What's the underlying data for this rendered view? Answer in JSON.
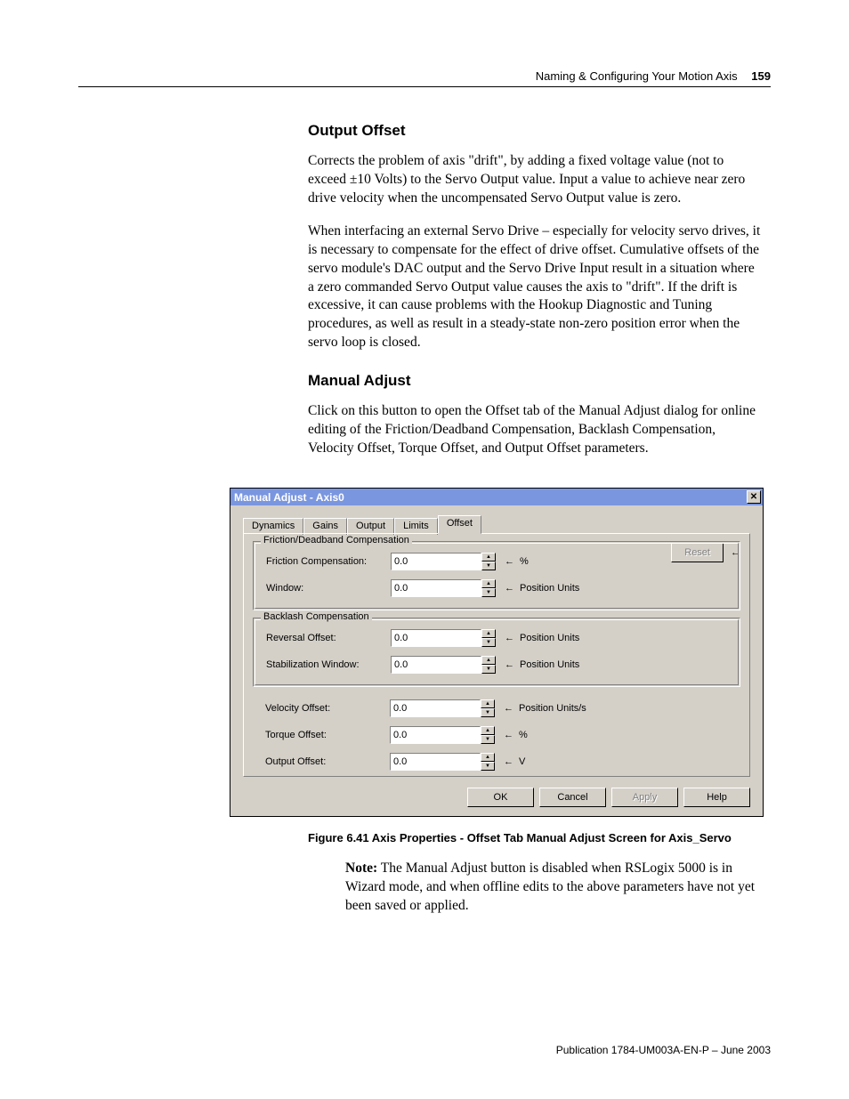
{
  "header": {
    "chapter": "Naming & Configuring Your Motion Axis",
    "page": "159"
  },
  "sections": {
    "output_offset": {
      "title": "Output Offset",
      "p1": "Corrects the problem of axis \"drift\", by adding a fixed voltage value (not to exceed ±10 Volts) to the Servo Output value. Input a value to achieve near zero drive velocity when the uncompensated Servo Output value is zero.",
      "p2": "When interfacing an external Servo Drive – especially for velocity servo drives, it is necessary to compensate for the effect of drive offset. Cumulative offsets of the servo module's DAC output and the Servo Drive Input result in a situation where a zero commanded Servo Output value causes the axis to \"drift\". If the drift is excessive, it can cause problems with the Hookup Diagnostic and Tuning procedures, as well as result in a steady-state non-zero position error when the servo loop is closed."
    },
    "manual_adjust": {
      "title": "Manual Adjust",
      "p1": "Click on this button to open the Offset tab of the Manual Adjust dialog for online editing of the Friction/Deadband Compensation, Backlash Compensation, Velocity Offset, Torque Offset, and Output Offset parameters."
    }
  },
  "dialog": {
    "title": "Manual Adjust - Axis0",
    "tabs": [
      "Dynamics",
      "Gains",
      "Output",
      "Limits",
      "Offset"
    ],
    "active_tab": "Offset",
    "group1": {
      "title": "Friction/Deadband Compensation",
      "friction_label": "Friction Compensation:",
      "friction_value": "0.0",
      "friction_unit": "%",
      "window_label": "Window:",
      "window_value": "0.0",
      "window_unit": "Position Units"
    },
    "group2": {
      "title": "Backlash Compensation",
      "reversal_label": "Reversal Offset:",
      "reversal_value": "0.0",
      "reversal_unit": "Position Units",
      "stab_label": "Stabilization Window:",
      "stab_value": "0.0",
      "stab_unit": "Position Units"
    },
    "velocity_label": "Velocity Offset:",
    "velocity_value": "0.0",
    "velocity_unit": "Position Units/s",
    "torque_label": "Torque Offset:",
    "torque_value": "0.0",
    "torque_unit": "%",
    "output_label": "Output Offset:",
    "output_value": "0.0",
    "output_unit": "V",
    "reset": "Reset",
    "buttons": {
      "ok": "OK",
      "cancel": "Cancel",
      "apply": "Apply",
      "help": "Help"
    }
  },
  "caption": "Figure 6.41 Axis Properties - Offset Tab Manual Adjust Screen for Axis_Servo",
  "note": {
    "bold": "Note:",
    "text": " The Manual Adjust button is disabled when RSLogix 5000 is in Wizard mode, and when offline edits to the above parameters have not yet been saved or applied."
  },
  "footer": "Publication 1784-UM003A-EN-P – June 2003"
}
